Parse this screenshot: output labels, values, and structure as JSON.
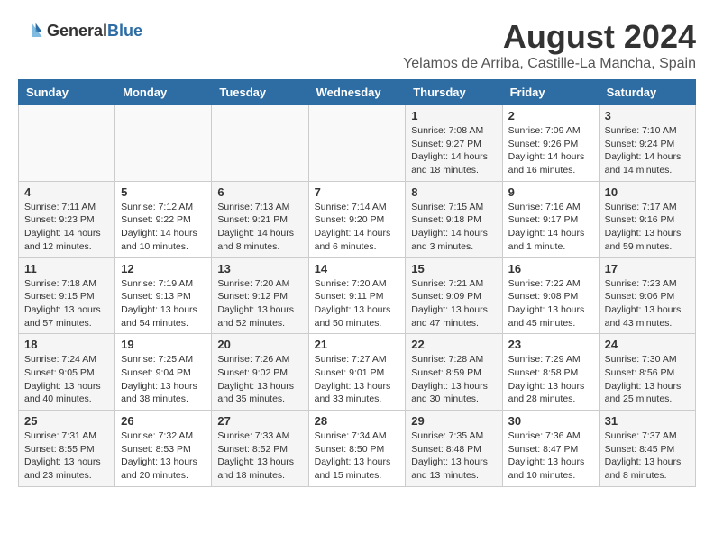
{
  "header": {
    "logo_general": "General",
    "logo_blue": "Blue",
    "month_year": "August 2024",
    "location": "Yelamos de Arriba, Castille-La Mancha, Spain"
  },
  "weekdays": [
    "Sunday",
    "Monday",
    "Tuesday",
    "Wednesday",
    "Thursday",
    "Friday",
    "Saturday"
  ],
  "weeks": [
    [
      {
        "day": "",
        "info": ""
      },
      {
        "day": "",
        "info": ""
      },
      {
        "day": "",
        "info": ""
      },
      {
        "day": "",
        "info": ""
      },
      {
        "day": "1",
        "info": "Sunrise: 7:08 AM\nSunset: 9:27 PM\nDaylight: 14 hours\nand 18 minutes."
      },
      {
        "day": "2",
        "info": "Sunrise: 7:09 AM\nSunset: 9:26 PM\nDaylight: 14 hours\nand 16 minutes."
      },
      {
        "day": "3",
        "info": "Sunrise: 7:10 AM\nSunset: 9:24 PM\nDaylight: 14 hours\nand 14 minutes."
      }
    ],
    [
      {
        "day": "4",
        "info": "Sunrise: 7:11 AM\nSunset: 9:23 PM\nDaylight: 14 hours\nand 12 minutes."
      },
      {
        "day": "5",
        "info": "Sunrise: 7:12 AM\nSunset: 9:22 PM\nDaylight: 14 hours\nand 10 minutes."
      },
      {
        "day": "6",
        "info": "Sunrise: 7:13 AM\nSunset: 9:21 PM\nDaylight: 14 hours\nand 8 minutes."
      },
      {
        "day": "7",
        "info": "Sunrise: 7:14 AM\nSunset: 9:20 PM\nDaylight: 14 hours\nand 6 minutes."
      },
      {
        "day": "8",
        "info": "Sunrise: 7:15 AM\nSunset: 9:18 PM\nDaylight: 14 hours\nand 3 minutes."
      },
      {
        "day": "9",
        "info": "Sunrise: 7:16 AM\nSunset: 9:17 PM\nDaylight: 14 hours\nand 1 minute."
      },
      {
        "day": "10",
        "info": "Sunrise: 7:17 AM\nSunset: 9:16 PM\nDaylight: 13 hours\nand 59 minutes."
      }
    ],
    [
      {
        "day": "11",
        "info": "Sunrise: 7:18 AM\nSunset: 9:15 PM\nDaylight: 13 hours\nand 57 minutes."
      },
      {
        "day": "12",
        "info": "Sunrise: 7:19 AM\nSunset: 9:13 PM\nDaylight: 13 hours\nand 54 minutes."
      },
      {
        "day": "13",
        "info": "Sunrise: 7:20 AM\nSunset: 9:12 PM\nDaylight: 13 hours\nand 52 minutes."
      },
      {
        "day": "14",
        "info": "Sunrise: 7:20 AM\nSunset: 9:11 PM\nDaylight: 13 hours\nand 50 minutes."
      },
      {
        "day": "15",
        "info": "Sunrise: 7:21 AM\nSunset: 9:09 PM\nDaylight: 13 hours\nand 47 minutes."
      },
      {
        "day": "16",
        "info": "Sunrise: 7:22 AM\nSunset: 9:08 PM\nDaylight: 13 hours\nand 45 minutes."
      },
      {
        "day": "17",
        "info": "Sunrise: 7:23 AM\nSunset: 9:06 PM\nDaylight: 13 hours\nand 43 minutes."
      }
    ],
    [
      {
        "day": "18",
        "info": "Sunrise: 7:24 AM\nSunset: 9:05 PM\nDaylight: 13 hours\nand 40 minutes."
      },
      {
        "day": "19",
        "info": "Sunrise: 7:25 AM\nSunset: 9:04 PM\nDaylight: 13 hours\nand 38 minutes."
      },
      {
        "day": "20",
        "info": "Sunrise: 7:26 AM\nSunset: 9:02 PM\nDaylight: 13 hours\nand 35 minutes."
      },
      {
        "day": "21",
        "info": "Sunrise: 7:27 AM\nSunset: 9:01 PM\nDaylight: 13 hours\nand 33 minutes."
      },
      {
        "day": "22",
        "info": "Sunrise: 7:28 AM\nSunset: 8:59 PM\nDaylight: 13 hours\nand 30 minutes."
      },
      {
        "day": "23",
        "info": "Sunrise: 7:29 AM\nSunset: 8:58 PM\nDaylight: 13 hours\nand 28 minutes."
      },
      {
        "day": "24",
        "info": "Sunrise: 7:30 AM\nSunset: 8:56 PM\nDaylight: 13 hours\nand 25 minutes."
      }
    ],
    [
      {
        "day": "25",
        "info": "Sunrise: 7:31 AM\nSunset: 8:55 PM\nDaylight: 13 hours\nand 23 minutes."
      },
      {
        "day": "26",
        "info": "Sunrise: 7:32 AM\nSunset: 8:53 PM\nDaylight: 13 hours\nand 20 minutes."
      },
      {
        "day": "27",
        "info": "Sunrise: 7:33 AM\nSunset: 8:52 PM\nDaylight: 13 hours\nand 18 minutes."
      },
      {
        "day": "28",
        "info": "Sunrise: 7:34 AM\nSunset: 8:50 PM\nDaylight: 13 hours\nand 15 minutes."
      },
      {
        "day": "29",
        "info": "Sunrise: 7:35 AM\nSunset: 8:48 PM\nDaylight: 13 hours\nand 13 minutes."
      },
      {
        "day": "30",
        "info": "Sunrise: 7:36 AM\nSunset: 8:47 PM\nDaylight: 13 hours\nand 10 minutes."
      },
      {
        "day": "31",
        "info": "Sunrise: 7:37 AM\nSunset: 8:45 PM\nDaylight: 13 hours\nand 8 minutes."
      }
    ]
  ]
}
